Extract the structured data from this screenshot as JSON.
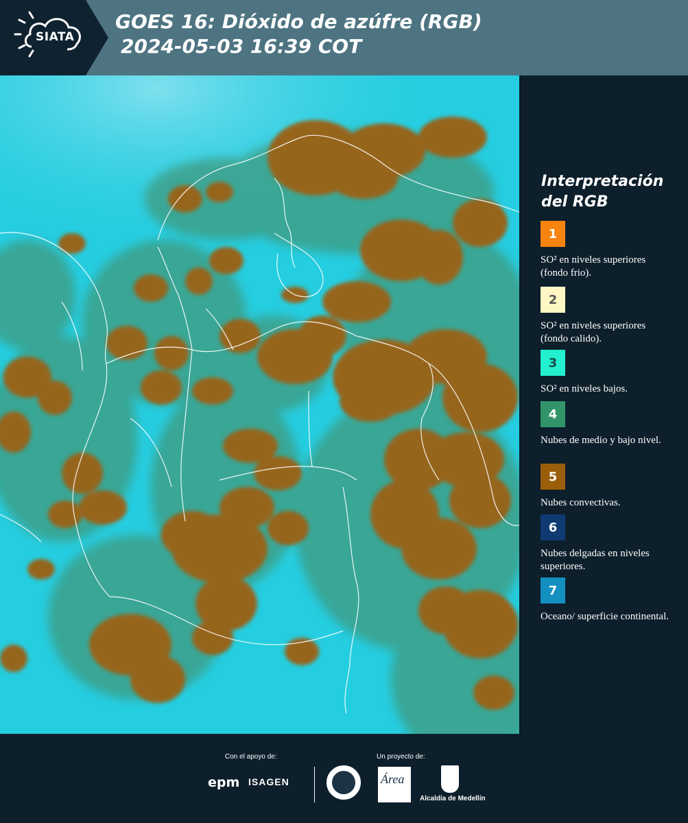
{
  "header": {
    "logo_text": "SIATA",
    "title_line1": "GOES 16: Dióxido de azúfre (RGB)",
    "title_line2": "2024-05-03 16:39 COT"
  },
  "legend": {
    "title_line1": "Interpretación",
    "title_line2": "del RGB",
    "items": [
      {
        "number": "1",
        "label": "SO² en niveles superiores (fondo frio).",
        "color": "#f7840f",
        "text_color": "#ffffff"
      },
      {
        "number": "2",
        "label": "SO² en niveles superiores (fondo calido).",
        "color": "#fff8c4",
        "text_color": "#555555"
      },
      {
        "number": "3",
        "label": "SO² en niveles bajos.",
        "color": "#22f0cf",
        "text_color": "#1b4a45"
      },
      {
        "number": "4",
        "label": "Nubes de medio y bajo nivel.",
        "color": "#32956a",
        "text_color": "#ffffff"
      },
      {
        "number": "5",
        "label": "Nubes convectivas.",
        "color": "#9b5e0a",
        "text_color": "#ffffff"
      },
      {
        "number": "6",
        "label": "Nubes delgadas en niveles superiores.",
        "color": "#0f3a72",
        "text_color": "#ffffff"
      },
      {
        "number": "7",
        "label": "Oceano/ superficie continental.",
        "color": "#1490c0",
        "text_color": "#ffffff"
      }
    ]
  },
  "footer": {
    "support_label": "Con el apoyo de:",
    "project_label": "Un proyecto de:",
    "epm": "epm",
    "isagen": "ISAGEN",
    "alcaldia": "Alcaldía de Medellín"
  },
  "map": {
    "background_color": "#25cde0",
    "convective_color": "#96651c",
    "mid_cloud_color": "#3f9a7e",
    "border_color": "#ffffff"
  }
}
